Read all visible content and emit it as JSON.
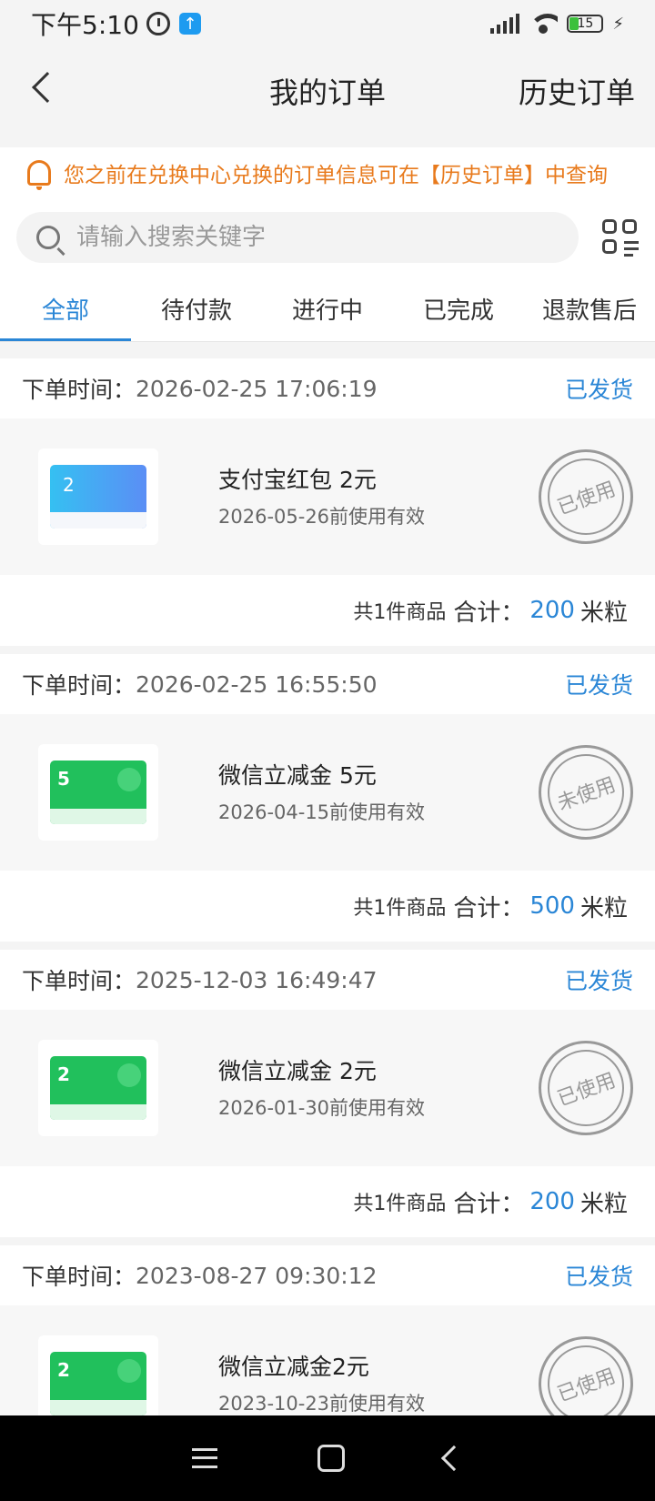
{
  "status_bar": {
    "time": "下午5:10",
    "battery": "15"
  },
  "nav": {
    "title": "我的订单",
    "history": "历史订单"
  },
  "notice": {
    "text": "您之前在兑换中心兑换的订单信息可在【历史订单】中查询"
  },
  "search": {
    "placeholder": "请输入搜索关键字"
  },
  "tabs": [
    "全部",
    "待付款",
    "进行中",
    "已完成",
    "退款售后"
  ],
  "orders": [
    {
      "label": "下单时间：",
      "time": "2026-02-25 17:06:19",
      "status": "已发货",
      "card": "alipay",
      "card_amount": "2",
      "item": "支付宝红包 2元",
      "valid": "2026-05-26前使用有效",
      "stamp": "已使用",
      "count": "共1件商品",
      "total_label": "合计：",
      "amount": "200",
      "unit": "米粒"
    },
    {
      "label": "下单时间：",
      "time": "2026-02-25 16:55:50",
      "status": "已发货",
      "card": "wechat",
      "card_amount": "5",
      "item": "微信立减金 5元",
      "valid": "2026-04-15前使用有效",
      "stamp": "未使用",
      "count": "共1件商品",
      "total_label": "合计：",
      "amount": "500",
      "unit": "米粒"
    },
    {
      "label": "下单时间：",
      "time": "2025-12-03 16:49:47",
      "status": "已发货",
      "card": "wechat",
      "card_amount": "2",
      "item": "微信立减金 2元",
      "valid": "2026-01-30前使用有效",
      "stamp": "已使用",
      "count": "共1件商品",
      "total_label": "合计：",
      "amount": "200",
      "unit": "米粒"
    },
    {
      "label": "下单时间：",
      "time": "2023-08-27 09:30:12",
      "status": "已发货",
      "card": "wechat",
      "card_amount": "2",
      "item": "微信立减金2元",
      "valid": "2023-10-23前使用有效",
      "stamp": "已使用"
    }
  ]
}
